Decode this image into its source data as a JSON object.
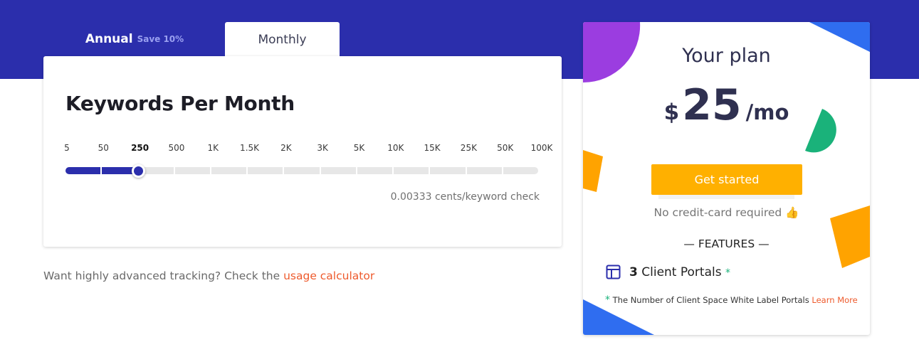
{
  "tabs": {
    "annual_label": "Annual",
    "annual_badge": "Save 10%",
    "monthly_label": "Monthly"
  },
  "keywords_card": {
    "title": "Keywords Per Month",
    "ticks": [
      "5",
      "50",
      "250",
      "500",
      "1K",
      "1.5K",
      "2K",
      "3K",
      "5K",
      "10K",
      "15K",
      "25K",
      "50K",
      "100K"
    ],
    "selected_index": 2,
    "selected_value": "250",
    "rate_text": "0.00333 cents/keyword check"
  },
  "footer": {
    "prefix": "Want highly advanced tracking? Check the",
    "link": "usage calculator"
  },
  "plan": {
    "title": "Your plan",
    "currency": "$",
    "amount": "25",
    "period": "/mo",
    "cta_label": "Get started",
    "no_cc": "No credit-card required",
    "thumbs_icon": "👍",
    "features_heading": "— FEATURES —",
    "feature_count": "3",
    "feature_label": "Client Portals",
    "feature_star": "*",
    "footnote_star": "*",
    "footnote_text": "The Number of Client Space White Label Portals",
    "footnote_link": "Learn More"
  },
  "colors": {
    "brand": "#2b2eac",
    "cta": "#ffb000",
    "link": "#ee5a2c",
    "accent_green": "#1ab27a"
  }
}
